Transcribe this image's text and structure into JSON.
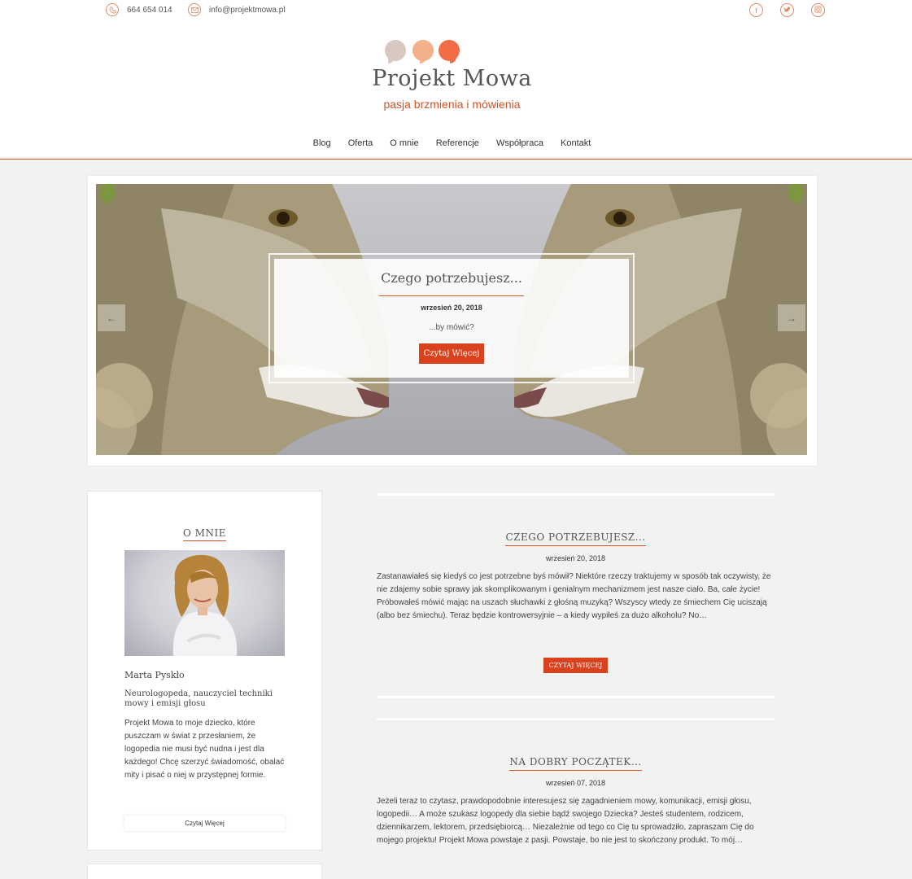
{
  "topbar": {
    "phone": "664 654 014",
    "email": "info@projektmowa.pl",
    "social": [
      {
        "icon": "facebook-icon",
        "glyph": "f"
      },
      {
        "icon": "twitter-icon",
        "glyph": "t"
      },
      {
        "icon": "instagram-icon",
        "glyph": "◙"
      }
    ]
  },
  "brand": {
    "title": "Projekt Mowa",
    "tagline": "pasja brzmienia i mówienia",
    "colors": {
      "bubble1": "#d9c8bf",
      "bubble2": "#f4b08a",
      "bubble3": "#f26d46",
      "accent": "#d1532a"
    }
  },
  "nav": [
    "Blog",
    "Oferta",
    "O mnie",
    "Referencje",
    "Współpraca",
    "Kontakt"
  ],
  "slider": {
    "title": "Czego potrzebujesz...",
    "date": "wrzesień 20, 2018",
    "excerpt": "...by mówić?",
    "button": "Czytaj Więcej",
    "prev": "←",
    "next": "→"
  },
  "sidebar": {
    "title": "O MNIE",
    "name": "Marta Pyskło",
    "role": "Neurologopeda, nauczyciel techniki mowy i emisji głosu",
    "bio": "Projekt Mowa to moje dziecko, które puszczam w świat z przesłaniem, że logopedia nie musi być nudna i jest dla każdego! Chcę szerzyć świadomość, obalać mity i pisać o niej w przystępnej formie.",
    "button": "Czytaj Więcej"
  },
  "posts": [
    {
      "title": "CZEGO POTRZEBUJESZ...",
      "date": "wrzesień 20, 2018",
      "body": "Zastanawiałeś się kiedyś co jest potrzebne byś mówił? Niektóre rzeczy traktujemy w sposób tak oczywisty, że nie zdajemy sobie sprawy jak skomplikowanym i genialnym mechanizmem jest nasze ciało. Ba, całe życie! Próbowałeś mówić mając na uszach słuchawki z głośną muzyką? Wszyscy wtedy ze śmiechem Cię uciszają (albo bez śmiechu). Teraz będzie kontrowersyjnie – a kiedy wypiłeś za dużo alkoholu? No…",
      "button": "CZYTAJ WIĘCEJ"
    },
    {
      "title": "NA DOBRY POCZĄTEK...",
      "date": "wrzesień 07, 2018",
      "body": "Jeżeli teraz to czytasz, prawdopodobnie interesujesz się zagadnieniem mowy, komunikacji, emisji głosu, logopedii… A może szukasz logopedy dla siebie bądź swojego Dziecka? Jesteś studentem, rodzicem, dziennikarzem, lektorem, przedsiębiorcą… Niezależnie od tego co Cię tu sprowadziło, zapraszam Cię do mojego projektu! Projekt Mowa powstaje z pasji. Powstaje, bo nie jest to skończony produkt. To mój…"
    }
  ]
}
